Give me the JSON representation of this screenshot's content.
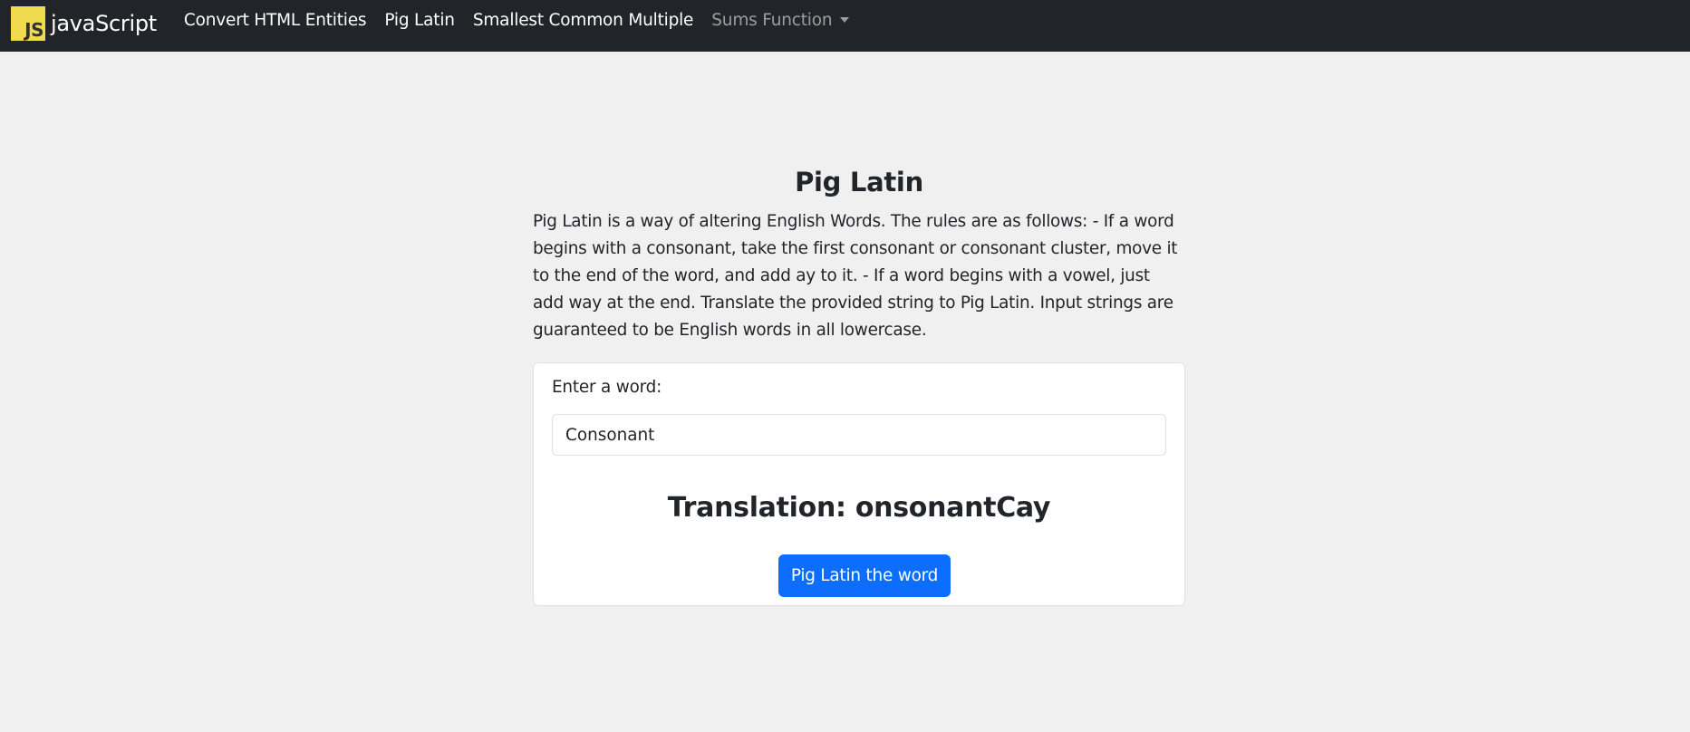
{
  "navbar": {
    "logo_text": "JS",
    "brand": "javaScript",
    "links": [
      {
        "label": "Convert HTML Entities"
      },
      {
        "label": "Pig Latin"
      },
      {
        "label": "Smallest Common Multiple"
      },
      {
        "label": "Sums Function"
      }
    ]
  },
  "main": {
    "title": "Pig Latin",
    "description": "Pig Latin is a way of altering English Words. The rules are as follows: - If a word begins with a consonant, take the first consonant or consonant cluster, move it to the end of the word, and add ay to it. - If a word begins with a vowel, just add way at the end. Translate the provided string to Pig Latin. Input strings are guaranteed to be English words in all lowercase.",
    "form": {
      "label": "Enter a word:",
      "input_value": "Consonant",
      "translation": "Translation: onsonantCay",
      "button_label": "Pig Latin the word"
    }
  },
  "colors": {
    "navbar_bg": "#212529",
    "page_bg": "#f0f0f0",
    "logo_bg": "#f0db4f",
    "button_bg": "#0d6efd"
  }
}
